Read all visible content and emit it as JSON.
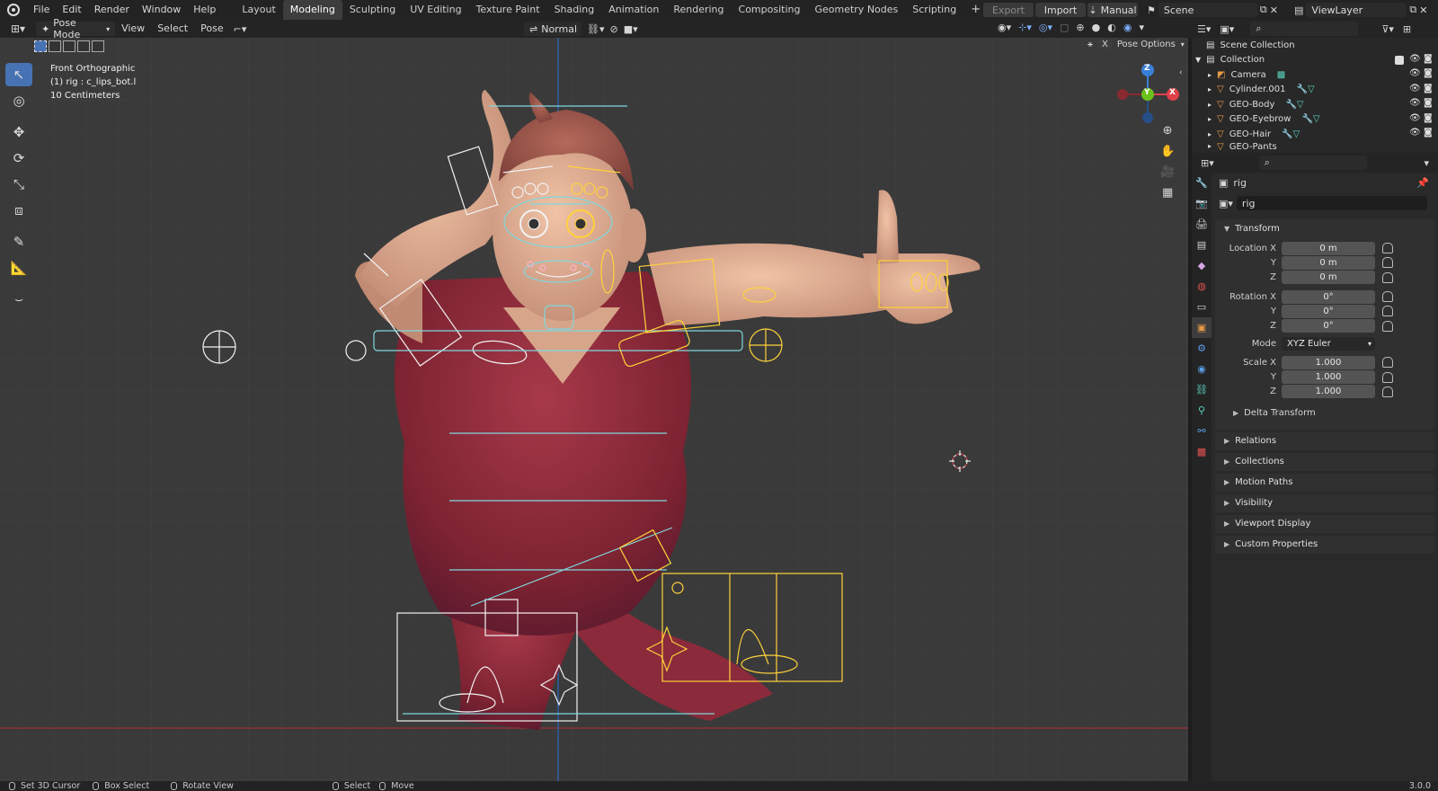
{
  "menu": [
    "File",
    "Edit",
    "Render",
    "Window",
    "Help"
  ],
  "workspaces": [
    {
      "label": "Layout"
    },
    {
      "label": "Modeling",
      "active": true
    },
    {
      "label": "Sculpting"
    },
    {
      "label": "UV Editing"
    },
    {
      "label": "Texture Paint"
    },
    {
      "label": "Shading"
    },
    {
      "label": "Animation"
    },
    {
      "label": "Rendering"
    },
    {
      "label": "Compositing"
    },
    {
      "label": "Geometry Nodes"
    },
    {
      "label": "Scripting"
    }
  ],
  "topright": {
    "export": "Export",
    "import": "Import",
    "manual": "Manual",
    "scene": "Scene",
    "viewlayer": "ViewLayer"
  },
  "viewport_header": {
    "mode": "Pose Mode",
    "view": "View",
    "select": "Select",
    "pose": "Pose",
    "orientation": "Normal",
    "pose_options": "Pose Options",
    "x_axis": "X"
  },
  "overlay_text": {
    "view_name": "Front Orthographic",
    "active": "(1) rig : c_lips_bot.l",
    "scale": "10 Centimeters"
  },
  "gizmo": {
    "x": "X",
    "y": "Y",
    "z": "Z"
  },
  "outliner": {
    "root": "Scene Collection",
    "collection": "Collection",
    "items": [
      "Camera",
      "Cylinder.001",
      "GEO-Body",
      "GEO-Eyebrow",
      "GEO-Hair",
      "GEO-Pants"
    ]
  },
  "properties": {
    "object_name": "rig",
    "data_name": "rig",
    "transform": "Transform",
    "location": {
      "label_x": "Location X",
      "label_y": "Y",
      "label_z": "Z",
      "x": "0 m",
      "y": "0 m",
      "z": "0 m"
    },
    "rotation": {
      "label_x": "Rotation X",
      "label_y": "Y",
      "label_z": "Z",
      "x": "0°",
      "y": "0°",
      "z": "0°"
    },
    "mode_label": "Mode",
    "mode_value": "XYZ Euler",
    "scale": {
      "label_x": "Scale X",
      "label_y": "Y",
      "label_z": "Z",
      "x": "1.000",
      "y": "1.000",
      "z": "1.000"
    },
    "delta": "Delta Transform",
    "panels": [
      "Relations",
      "Collections",
      "Motion Paths",
      "Visibility",
      "Viewport Display",
      "Custom Properties"
    ]
  },
  "status": {
    "cursor": "Set 3D Cursor",
    "box": "Box Select",
    "rotate": "Rotate View",
    "select": "Select",
    "move": "Move",
    "version": "3.0.0"
  },
  "colors": {
    "accent": "#4772b3",
    "rig_white": "#f2f2f2",
    "rig_yellow": "#ffd23c",
    "rig_cyan": "#7fd8df",
    "axis_x": "#e0404a",
    "axis_y": "#6cc21d",
    "axis_z": "#3a7fd9"
  }
}
